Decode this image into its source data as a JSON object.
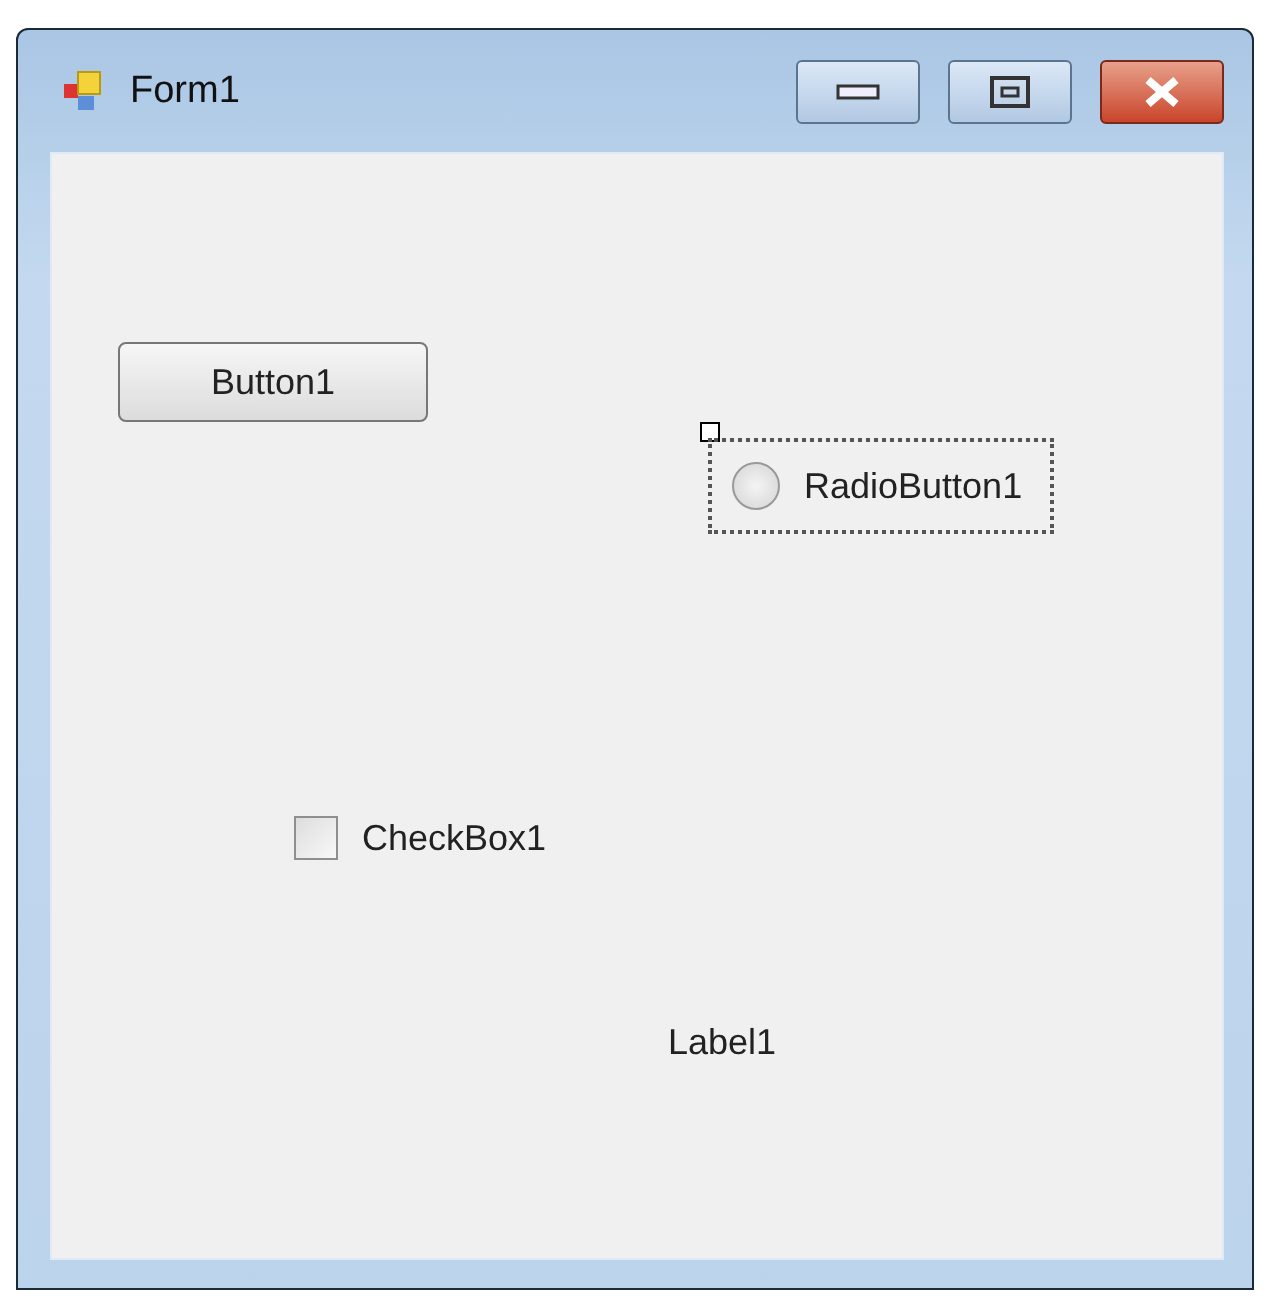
{
  "window": {
    "title": "Form1"
  },
  "controls": [
    {
      "kind": "button",
      "text": "Button1",
      "selected": false
    },
    {
      "kind": "radio",
      "text": "RadioButton1",
      "checked": false,
      "selected": true
    },
    {
      "kind": "checkbox",
      "text": "CheckBox1",
      "checked": false,
      "selected": false
    },
    {
      "kind": "label",
      "text": "Label1",
      "selected": false
    }
  ]
}
